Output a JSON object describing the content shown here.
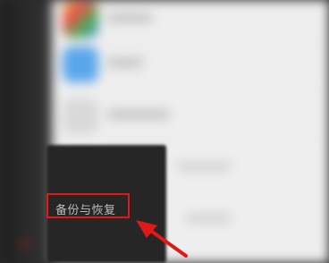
{
  "menu": {
    "backup_restore_label": "备份与恢复"
  },
  "colors": {
    "highlight": "#e01818",
    "popup_bg": "#262626",
    "panel_bg": "#eeeeee",
    "arrow": "#e01818"
  },
  "icons": [
    "app-icon-multicolor",
    "app-icon-blue",
    "app-icon-blurred"
  ]
}
